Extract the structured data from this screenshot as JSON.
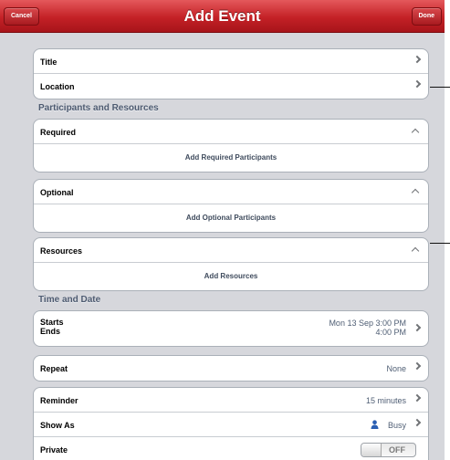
{
  "navbar": {
    "title": "Add Event",
    "cancel_label": "Cancel",
    "done_label": "Done"
  },
  "basic": {
    "title_label": "Title",
    "location_label": "Location"
  },
  "sections": {
    "participants": "Participants and Resources",
    "time_date": "Time and Date"
  },
  "required": {
    "label": "Required",
    "add_label": "Add Required Participants"
  },
  "optional": {
    "label": "Optional",
    "add_label": "Add Optional Participants"
  },
  "resources": {
    "label": "Resources",
    "add_label": "Add Resources"
  },
  "time": {
    "starts_label": "Starts",
    "ends_label": "Ends",
    "starts_value": "Mon 13 Sep  3:00 PM",
    "ends_value": "4:00 PM"
  },
  "repeat": {
    "label": "Repeat",
    "value": "None"
  },
  "details": {
    "reminder_label": "Reminder",
    "reminder_value": "15 minutes",
    "show_as_label": "Show As",
    "show_as_value": "Busy",
    "private_label": "Private",
    "private_value": "OFF"
  },
  "icons": {
    "chevron": "chevron-right-icon",
    "collapse": "chevron-up-icon",
    "person": "person-icon"
  },
  "colors": {
    "navbar": "#c42126",
    "background": "#d6d7dc",
    "section_text": "#4d5a70",
    "value_text": "#4f5e74"
  }
}
